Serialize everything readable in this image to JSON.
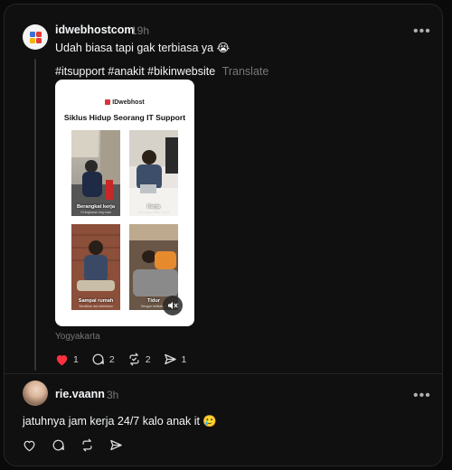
{
  "post": {
    "username": "idwebhostcom",
    "time": "19h",
    "text": "Udah biasa tapi gak terbiasa ya 😭",
    "hashtags": "#itsupport #anakit #bikinwebsite",
    "translate": "Translate",
    "media": {
      "brand": "IDwebhost",
      "title": "Siklus Hidup Seorang IT Support",
      "tiles": [
        {
          "caption": "Berangkat kerja",
          "sub": "Di lingkaran ring road"
        },
        {
          "caption": "Kerja",
          "sub": "Menunggu lelah kantor"
        },
        {
          "caption": "Sampai rumah",
          "sub": "Sendirian dan kelelahan"
        },
        {
          "caption": "Tidur",
          "sub": "Dengan kelelahan"
        }
      ]
    },
    "location": "Yogyakarta",
    "likes": "1",
    "comments": "2",
    "reposts": "2",
    "shares": "1",
    "liked_color": "#ff3040"
  },
  "reply": {
    "username": "rie.vaann",
    "time": "3h",
    "text": "jatuhnya jam kerja 24/7 kalo anak it 🥲"
  },
  "icons": {
    "like": "heart-icon",
    "comment": "comment-bubble-icon",
    "repost": "repost-icon",
    "share": "send-icon",
    "more": "more-horizontal-icon",
    "mute": "speaker-muted-icon"
  }
}
